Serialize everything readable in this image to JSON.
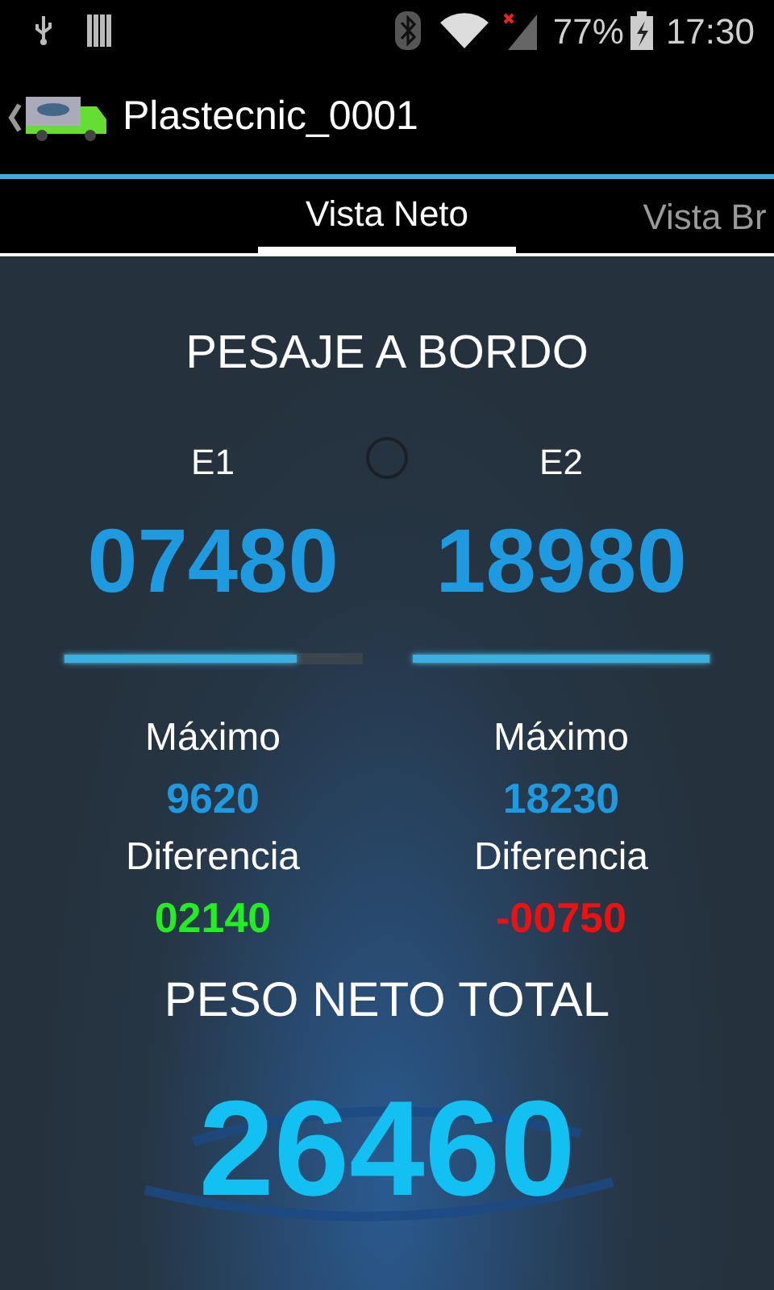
{
  "status_bar": {
    "battery": "77%",
    "time": "17:30"
  },
  "action_bar": {
    "title": "Plastecnic_0001"
  },
  "tabs": [
    {
      "label": "Vista Neto",
      "selected": true
    },
    {
      "label": "Vista Br",
      "selected": false
    }
  ],
  "panel": {
    "title": "PESAJE A BORDO",
    "axles": [
      {
        "name": "E1",
        "weight": "07480",
        "level": 0.78,
        "max_label": "Máximo",
        "max": "9620",
        "diff_label": "Diferencia",
        "diff": "02140",
        "color": "#22ee22"
      },
      {
        "name": "E2",
        "weight": "18980",
        "level": 1,
        "max_label": "Máximo",
        "max": "18230",
        "diff_label": "Diferencia",
        "diff": "-00750",
        "color": "#ee1111"
      }
    ],
    "total_label": "PESO NETO TOTAL",
    "total": "26460"
  }
}
